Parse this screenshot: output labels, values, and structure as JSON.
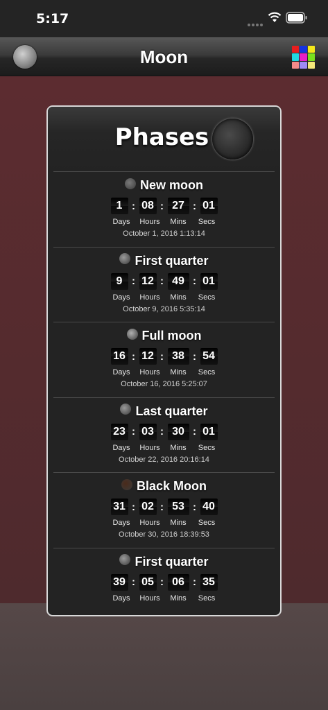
{
  "status_bar": {
    "time": "5:17"
  },
  "nav": {
    "title": "Moon",
    "grid_colors": [
      "#e81e1e",
      "#1633e0",
      "#f5e81a",
      "#21d9e0",
      "#e81ec8",
      "#7ae01e",
      "#f58a8a",
      "#9f8af5",
      "#f5e87a"
    ]
  },
  "card": {
    "title": "Phases",
    "phases": [
      {
        "name": "New moon",
        "days": "1",
        "hours": "08",
        "mins": "27",
        "secs": "01",
        "date": "October 1, 2016  1:13:14",
        "icon": "new-moon-icon",
        "icon_color": "#7a7a7a"
      },
      {
        "name": "First quarter",
        "days": "9",
        "hours": "12",
        "mins": "49",
        "secs": "01",
        "date": "October 9, 2016  5:35:14",
        "icon": "first-quarter-icon",
        "icon_color": "#9a9a9a"
      },
      {
        "name": "Full moon",
        "days": "16",
        "hours": "12",
        "mins": "38",
        "secs": "54",
        "date": "October 16, 2016  5:25:07",
        "icon": "full-moon-icon",
        "icon_color": "#b0b0b0"
      },
      {
        "name": "Last quarter",
        "days": "23",
        "hours": "03",
        "mins": "30",
        "secs": "01",
        "date": "October 22, 2016  20:16:14",
        "icon": "last-quarter-icon",
        "icon_color": "#9a9a9a"
      },
      {
        "name": "Black Moon",
        "days": "31",
        "hours": "02",
        "mins": "53",
        "secs": "40",
        "date": "October 30, 2016  18:39:53",
        "icon": "black-moon-icon",
        "icon_color": "#4a2a1a"
      },
      {
        "name": "First quarter",
        "days": "39",
        "hours": "05",
        "mins": "06",
        "secs": "35",
        "date": "",
        "icon": "first-quarter-icon",
        "icon_color": "#9a9a9a"
      }
    ],
    "units": {
      "days": "Days",
      "hours": "Hours",
      "mins": "Mins",
      "secs": "Secs"
    },
    "separator": ":"
  }
}
